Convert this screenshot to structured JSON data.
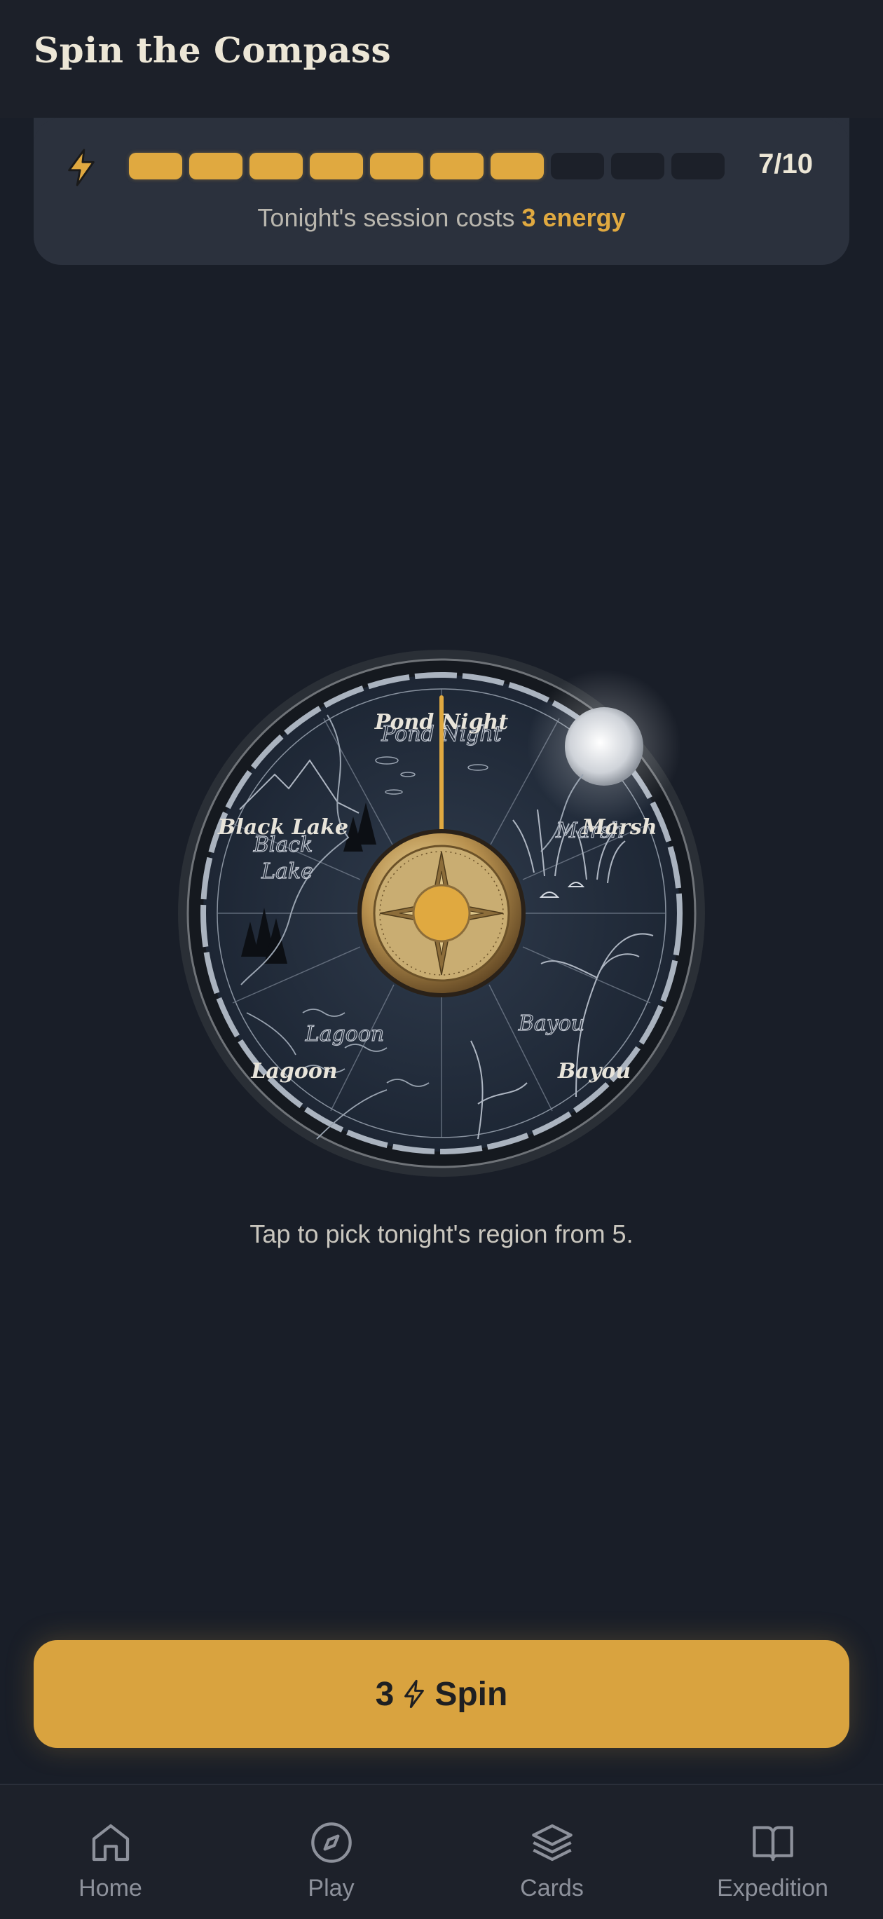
{
  "header": {
    "title": "Spin the Compass"
  },
  "energy": {
    "current": 7,
    "max": 10,
    "count_label": "7/10",
    "cost_prefix": "Tonight's session costs",
    "cost_highlight": "3 energy",
    "icon": "lightning-bolt-icon"
  },
  "compass": {
    "regions": [
      "Pond Night",
      "Marsh",
      "Bayou",
      "Lagoon",
      "Black Lake"
    ],
    "sketch_labels": {
      "pond": "Pond Night",
      "marsh": "Marsh",
      "bayou": "Bayou",
      "lagoon": "Lagoon",
      "black_lake_1": "Black",
      "black_lake_2": "Lake"
    },
    "accent": "#e0a940"
  },
  "caption": "Tap to pick tonight's region from 5.",
  "spin_button": {
    "cost": "3",
    "label": "Spin",
    "icon": "lightning-bolt-icon"
  },
  "nav": [
    {
      "label": "Home",
      "icon": "home-icon"
    },
    {
      "label": "Play",
      "icon": "compass-icon"
    },
    {
      "label": "Cards",
      "icon": "layers-icon"
    },
    {
      "label": "Expedition",
      "icon": "book-icon"
    }
  ],
  "colors": {
    "background": "#191e28",
    "card": "#2b313d",
    "accent": "#e0a940",
    "text": "#ece6d6"
  }
}
